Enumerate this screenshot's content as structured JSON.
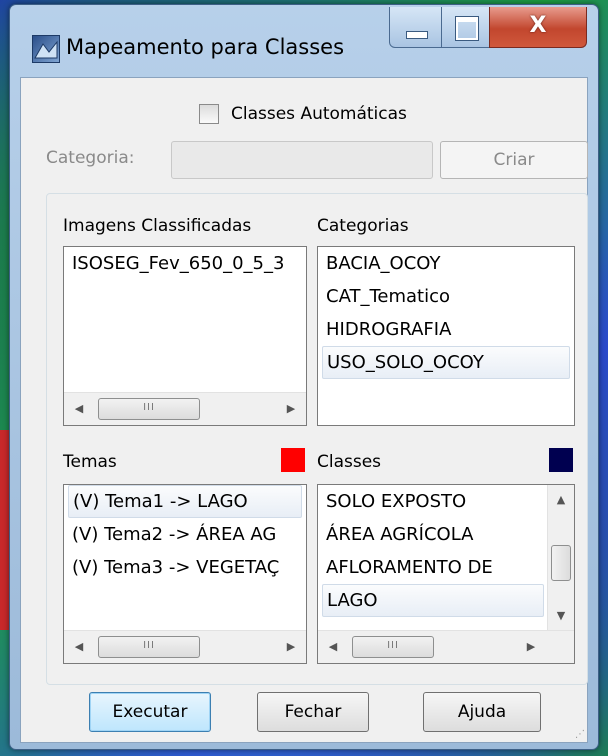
{
  "window": {
    "title": "Mapeamento para Classes"
  },
  "auto_classes": {
    "label": "Classes Automáticas",
    "checked": false
  },
  "categoria": {
    "label": "Categoria:",
    "value": "",
    "button": "Criar"
  },
  "imagens": {
    "label": "Imagens Classificadas",
    "items": [
      "ISOSEG_Fev_650_0_5_3"
    ]
  },
  "categorias": {
    "label": "Categorias",
    "items": [
      "BACIA_OCOY",
      "CAT_Tematico",
      "HIDROGRAFIA",
      "USO_SOLO_OCOY"
    ],
    "selected_index": 3
  },
  "temas": {
    "label": "Temas",
    "color": "#ff0000",
    "items": [
      "(V) Tema1 -> LAGO",
      "(V) Tema2 -> ÁREA AG",
      "(V) Tema3 -> VEGETAÇ"
    ],
    "selected_index": 0
  },
  "classes": {
    "label": "Classes",
    "color": "#000050",
    "items": [
      "SOLO EXPOSTO",
      "ÁREA AGRÍCOLA",
      "AFLORAMENTO DE",
      "LAGO"
    ],
    "selected_index": 3
  },
  "buttons": {
    "executar": "Executar",
    "fechar": "Fechar",
    "ajuda": "Ajuda"
  },
  "icons": {
    "hscroll_grip": "III",
    "close": "X"
  }
}
